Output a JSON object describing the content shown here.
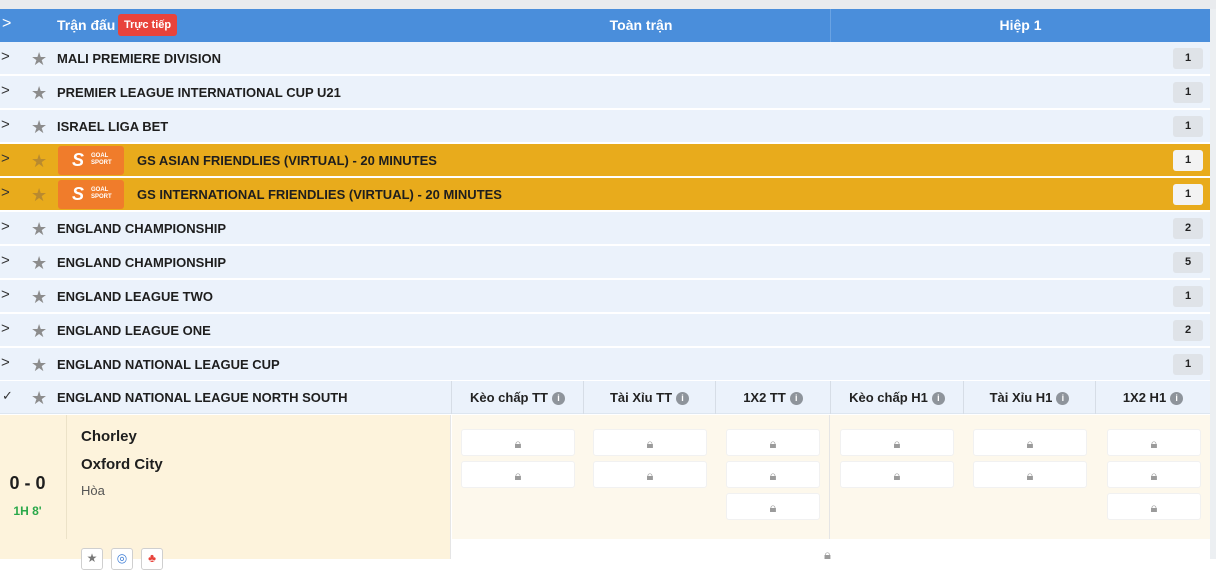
{
  "header": {
    "title": "Trận đấu",
    "live_badge": "Trực tiếp",
    "full_match": "Toàn trận",
    "half1": "Hiệp 1"
  },
  "leagues": [
    {
      "name": "MALI PREMIERE DIVISION",
      "count": "1",
      "highlight": false
    },
    {
      "name": "PREMIER LEAGUE INTERNATIONAL CUP U21",
      "count": "1",
      "highlight": false
    },
    {
      "name": "ISRAEL LIGA BET",
      "count": "1",
      "highlight": false
    },
    {
      "name": "GS ASIAN FRIENDLIES (VIRTUAL) - 20 MINUTES",
      "count": "1",
      "highlight": true
    },
    {
      "name": "GS INTERNATIONAL FRIENDLIES (VIRTUAL) - 20 MINUTES",
      "count": "1",
      "highlight": true
    },
    {
      "name": "ENGLAND CHAMPIONSHIP",
      "count": "2",
      "highlight": false
    },
    {
      "name": "ENGLAND CHAMPIONSHIP",
      "count": "5",
      "highlight": false
    },
    {
      "name": "ENGLAND LEAGUE TWO",
      "count": "1",
      "highlight": false
    },
    {
      "name": "ENGLAND LEAGUE ONE",
      "count": "2",
      "highlight": false
    },
    {
      "name": "ENGLAND NATIONAL LEAGUE CUP",
      "count": "1",
      "highlight": false
    }
  ],
  "gs_logo": {
    "letter": "S",
    "line1": "GOAL",
    "line2": "SPORT"
  },
  "expanded": {
    "name": "ENGLAND NATIONAL LEAGUE NORTH SOUTH",
    "columns": [
      "Kèo chấp TT",
      "Tài Xỉu TT",
      "1X2 TT",
      "Kèo chấp H1",
      "Tài Xỉu H1",
      "1X2 H1"
    ],
    "info_glyph": "i"
  },
  "match": {
    "home": "Chorley",
    "away": "Oxford City",
    "draw": "Hòa",
    "score": "0 - 0",
    "time": "1H 8'"
  },
  "icons": {
    "chevron": "chevron-right",
    "star": "star",
    "lock": "lock",
    "info": "info"
  },
  "colors": {
    "header_bg": "#4a8edb",
    "live_badge": "#e8433b",
    "highlight_row": "#e8ab1c",
    "match_bg": "#fdf3dc",
    "time_green": "#2aa84a"
  }
}
